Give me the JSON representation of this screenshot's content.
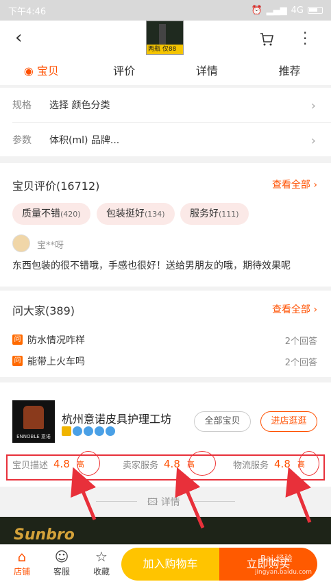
{
  "status": {
    "time": "下午4:46",
    "network": "4G"
  },
  "nav": {
    "thumb_tag": "两瓶 仅88"
  },
  "tabs": [
    "宝贝",
    "评价",
    "详情",
    "推荐"
  ],
  "specs": [
    {
      "label": "规格",
      "value": "选择 颜色分类"
    },
    {
      "label": "参数",
      "value": "体积(ml) 品牌..."
    }
  ],
  "reviews": {
    "title": "宝贝评价(16712)",
    "see_all": "查看全部",
    "chips": [
      {
        "text": "质量不错",
        "count": "(420)"
      },
      {
        "text": "包装挺好",
        "count": "(134)"
      },
      {
        "text": "服务好",
        "count": "(111)"
      }
    ],
    "user": "宝**呀",
    "comment": "东西包装的很不错哦，手感也很好！送给男朋友的哦，期待效果呢"
  },
  "qa": {
    "title": "问大家(389)",
    "see_all": "查看全部",
    "icon_text": "问",
    "items": [
      {
        "q": "防水情况咋样",
        "a": "2个回答"
      },
      {
        "q": "能带上火车吗",
        "a": "2个回答"
      }
    ]
  },
  "shop": {
    "name": "杭州意诺皮具护理工坊",
    "logo_text": "ENNOBLE 意诺",
    "all_items": "全部宝贝",
    "visit": "进店逛逛",
    "scores": [
      {
        "label": "宝贝描述",
        "value": "4.8",
        "level": "高"
      },
      {
        "label": "卖家服务",
        "value": "4.8",
        "level": "高"
      },
      {
        "label": "物流服务",
        "value": "4.8",
        "level": "高"
      }
    ]
  },
  "detail_label": "详情",
  "banner_text": "Sunbro",
  "bottom": {
    "shop": "店铺",
    "service": "客服",
    "fav": "收藏",
    "add_cart": "加入购物车",
    "buy": "立即购买"
  },
  "watermark": {
    "line1": "Bai 经验",
    "line2": "jingyan.baidu.com"
  },
  "colors": {
    "accent": "#ff5000",
    "cart": "#ffc400",
    "buy": "#ff5a00",
    "annotation": "#e8303a"
  }
}
